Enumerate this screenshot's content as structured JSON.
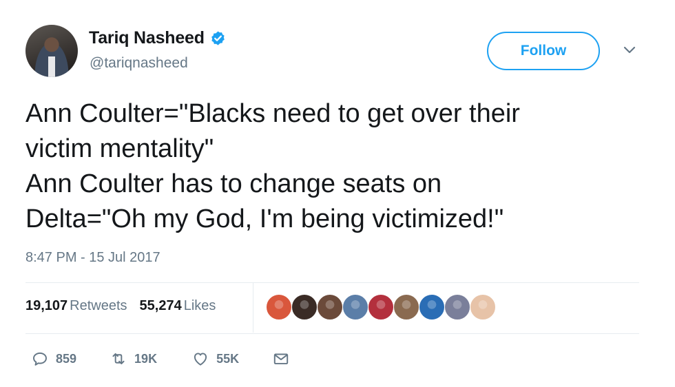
{
  "author": {
    "display_name": "Tariq Nasheed",
    "handle": "@tariqnasheed",
    "verified": true
  },
  "follow_label": "Follow",
  "tweet_lines": [
    "Ann Coulter=\"Blacks need to get over their",
    "victim mentality\"",
    "Ann Coulter has to change seats on",
    "Delta=\"Oh my God, I'm being victimized!\""
  ],
  "timestamp": "8:47 PM - 15 Jul 2017",
  "stats": {
    "retweets_count": "19,107",
    "retweets_label": "Retweets",
    "likes_count": "55,274",
    "likes_label": "Likes"
  },
  "liker_avatars": [
    {
      "name": "liker-avatar-1",
      "color": "#d9573c"
    },
    {
      "name": "liker-avatar-2",
      "color": "#3a2b25"
    },
    {
      "name": "liker-avatar-3",
      "color": "#6b4a3a"
    },
    {
      "name": "liker-avatar-4",
      "color": "#5b7ea8"
    },
    {
      "name": "liker-avatar-5",
      "color": "#b3303d"
    },
    {
      "name": "liker-avatar-6",
      "color": "#8a6a50"
    },
    {
      "name": "liker-avatar-7",
      "color": "#2a6db5"
    },
    {
      "name": "liker-avatar-8",
      "color": "#7a7f9a"
    },
    {
      "name": "liker-avatar-9",
      "color": "#e7c3a8"
    }
  ],
  "actions": {
    "replies": "859",
    "retweets": "19K",
    "likes": "55K"
  },
  "colors": {
    "accent": "#1da1f2",
    "secondary_text": "#657786",
    "divider": "#e6ecf0"
  }
}
